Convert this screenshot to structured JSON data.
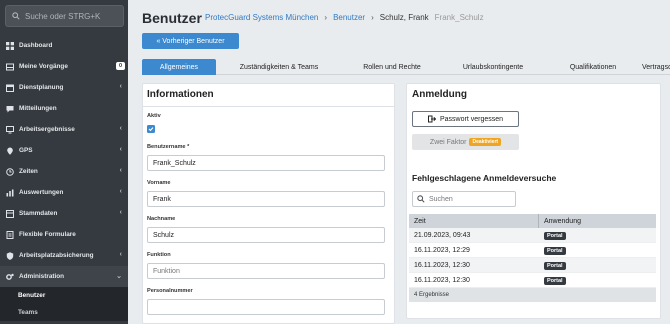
{
  "sidebar": {
    "search_placeholder": "Suche oder STRG+K",
    "items": [
      {
        "label": "Dashboard",
        "icon": "dashboard-icon"
      },
      {
        "label": "Meine Vorgänge",
        "icon": "inbox-icon",
        "badge": "0"
      },
      {
        "label": "Dienstplanung",
        "icon": "calendar-icon"
      },
      {
        "label": "Mitteilungen",
        "icon": "message-icon"
      },
      {
        "label": "Arbeitsergebnisse",
        "icon": "monitor-icon"
      },
      {
        "label": "GPS",
        "icon": "location-icon"
      },
      {
        "label": "Zeiten",
        "icon": "clock-icon"
      },
      {
        "label": "Auswertungen",
        "icon": "chart-icon"
      },
      {
        "label": "Stammdaten",
        "icon": "database-icon"
      },
      {
        "label": "Flexible Formulare",
        "icon": "form-icon"
      },
      {
        "label": "Arbeitsplatzabsicherung",
        "icon": "shield-icon"
      },
      {
        "label": "Administration",
        "icon": "gears-icon"
      }
    ],
    "sub_items": [
      "Benutzer",
      "Teams"
    ]
  },
  "header": {
    "title": "Benutzer",
    "breadcrumb": [
      "ProtecGuard Systems München",
      "Benutzer",
      "Schulz, Frank",
      "Frank_Schulz"
    ]
  },
  "prev_button": "« Vorheriger Benutzer",
  "tabs": [
    "Allgemeines",
    "Zuständigkeiten & Teams",
    "Rollen und Rechte",
    "Urlaubskontingente",
    "Qualifikationen",
    "Vertragsdaten"
  ],
  "info": {
    "title": "Informationen",
    "active_label": "Aktiv",
    "fields": [
      {
        "label": "Benutzername *",
        "value": "Frank_Schulz",
        "placeholder": ""
      },
      {
        "label": "Vorname",
        "value": "Frank",
        "placeholder": ""
      },
      {
        "label": "Nachname",
        "value": "Schulz",
        "placeholder": ""
      },
      {
        "label": "Funktion",
        "value": "",
        "placeholder": "Funktion"
      },
      {
        "label": "Personalnummer",
        "value": "",
        "placeholder": ""
      }
    ]
  },
  "login": {
    "title": "Anmeldung",
    "forgot_password": "Passwort vergessen",
    "two_factor": "Zwei Faktor",
    "two_factor_badge": "Deaktiviert",
    "failed_title": "Fehlgeschlagene Anmeldeversuche",
    "search_placeholder": "Suchen",
    "columns": [
      "Zeit",
      "Anwendung"
    ],
    "rows": [
      {
        "time": "21.09.2023, 09:43",
        "app": "Portal"
      },
      {
        "time": "16.11.2023, 12:29",
        "app": "Portal"
      },
      {
        "time": "16.11.2023, 12:30",
        "app": "Portal"
      },
      {
        "time": "16.11.2023, 12:30",
        "app": "Portal"
      }
    ],
    "result_count": "4 Ergebnisse"
  },
  "colors": {
    "accent": "#3c89d0",
    "sidebar": "#343a40",
    "warning": "#f0a522"
  }
}
